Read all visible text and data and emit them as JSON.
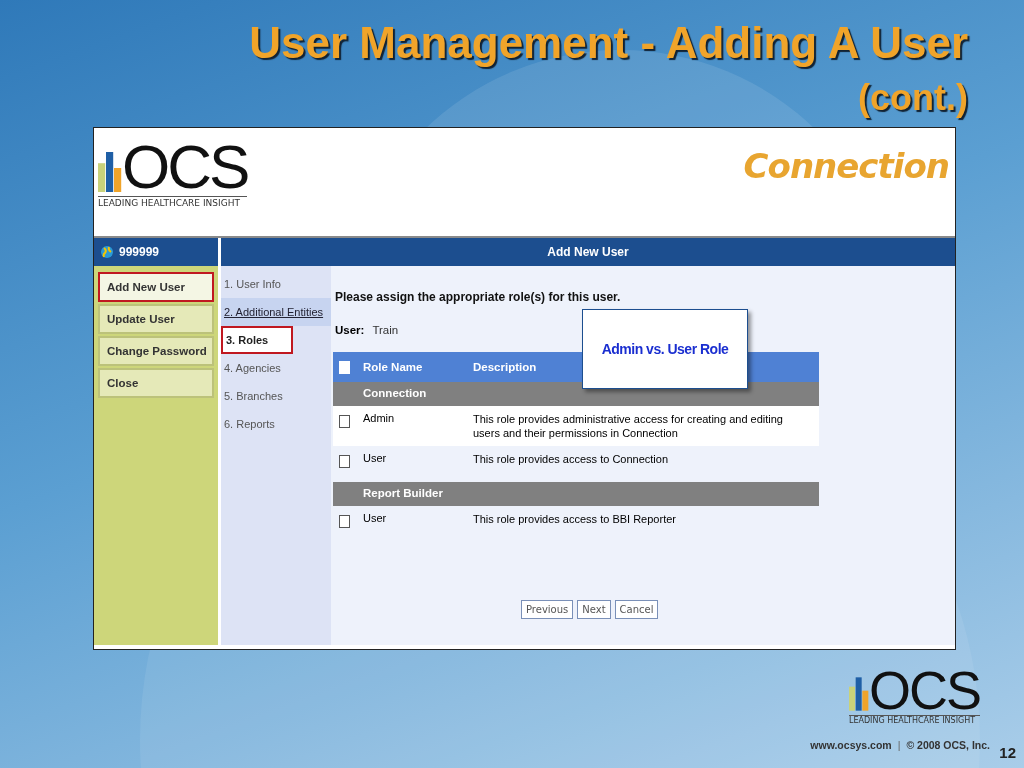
{
  "slide": {
    "title": "User Management - Adding A User",
    "subtitle": "(cont.)",
    "footer_url": "www.ocsys.com",
    "footer_separator": "|",
    "footer_copyright": "© 2008 OCS, Inc.",
    "page_number": "12"
  },
  "footer_logo": {
    "text": "OCS",
    "tagline": "LEADING HEALTHCARE INSIGHT"
  },
  "app": {
    "logo": {
      "text": "OCS",
      "tagline": "LEADING HEALTHCARE INSIGHT"
    },
    "product": "Connection",
    "account": "999999",
    "page_title": "Add New User",
    "menu": [
      {
        "label": "Add New User",
        "highlighted": true
      },
      {
        "label": "Update User",
        "highlighted": false
      },
      {
        "label": "Change Password",
        "highlighted": false
      },
      {
        "label": "Close",
        "highlighted": false
      }
    ],
    "steps": [
      {
        "label": "1. User Info",
        "selected": false,
        "linked": false,
        "highlighted": false
      },
      {
        "label": "2. Additional Entities",
        "selected": false,
        "linked": true,
        "highlighted": false
      },
      {
        "label": "3. Roles",
        "selected": true,
        "linked": false,
        "highlighted": true
      },
      {
        "label": "4. Agencies",
        "selected": false,
        "linked": false,
        "highlighted": false
      },
      {
        "label": "5. Branches",
        "selected": false,
        "linked": false,
        "highlighted": false
      },
      {
        "label": "6. Reports",
        "selected": false,
        "linked": false,
        "highlighted": false
      }
    ],
    "instruction": "Please assign the appropriate role(s) for this user.",
    "user_label": "User:",
    "user_value": "Train",
    "table": {
      "select_all_checked": false,
      "columns": [
        "Role Name",
        "Description"
      ],
      "rows": [
        {
          "kind": "group",
          "name": "Connection"
        },
        {
          "kind": "role",
          "checked": false,
          "name": "Admin",
          "description": "This role provides administrative access for creating and editing users and their permissions in Connection"
        },
        {
          "kind": "role",
          "checked": false,
          "name": "User",
          "description": "This role provides access to Connection"
        },
        {
          "kind": "group",
          "name": "Report Builder"
        },
        {
          "kind": "role",
          "checked": false,
          "name": "User",
          "description": "This role provides access to BBI Reporter"
        }
      ]
    },
    "buttons": [
      "Previous",
      "Next",
      "Cancel"
    ]
  },
  "callout": {
    "text": "Admin vs. User Role"
  }
}
